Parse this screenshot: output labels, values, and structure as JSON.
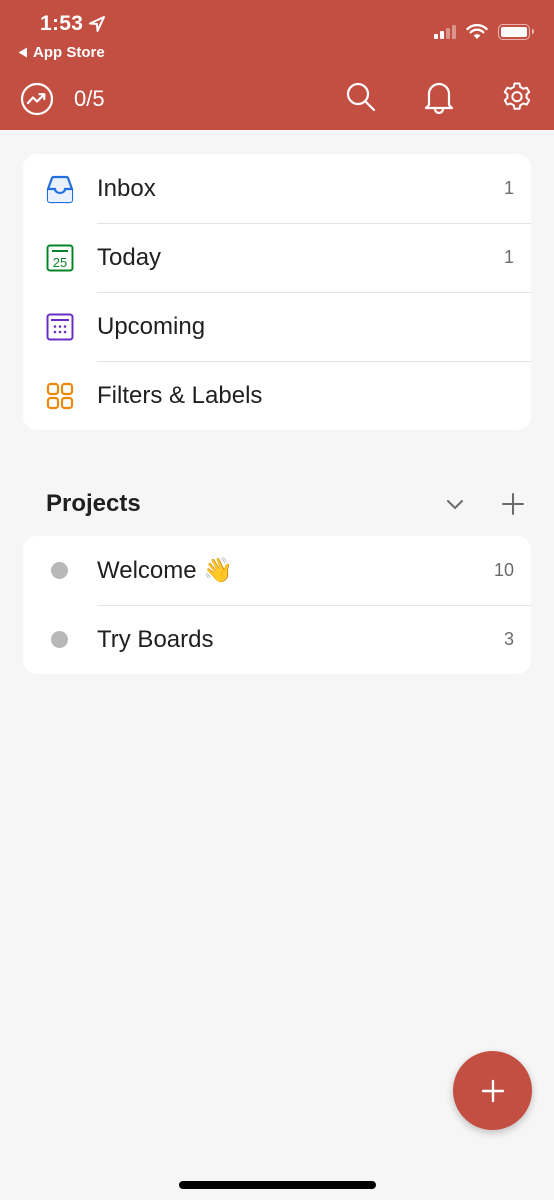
{
  "status_bar": {
    "time": "1:53",
    "back_label": "App Store",
    "signal_bars_active": 2,
    "signal_bars_total": 4,
    "battery_level": 1.0
  },
  "header": {
    "karma_icon": "productivity-trend-icon",
    "karma_progress": "0/5",
    "actions": [
      {
        "name": "search",
        "icon": "search-icon"
      },
      {
        "name": "notifications",
        "icon": "bell-icon"
      },
      {
        "name": "settings",
        "icon": "gear-icon"
      }
    ],
    "accent_color": "#c24f41"
  },
  "nav": {
    "items": [
      {
        "label": "Inbox",
        "count": "1",
        "icon": "inbox-icon",
        "color": "#246fe0"
      },
      {
        "label": "Today",
        "count": "1",
        "icon": "calendar-today-icon",
        "day": "25",
        "color": "#058527"
      },
      {
        "label": "Upcoming",
        "count": "",
        "icon": "calendar-upcoming-icon",
        "color": "#692fc2"
      },
      {
        "label": "Filters & Labels",
        "count": "",
        "icon": "filters-grid-icon",
        "color": "#eb8909"
      }
    ]
  },
  "projects": {
    "title": "Projects",
    "items": [
      {
        "label": "Welcome 👋",
        "count": "10",
        "color": "#b8b8b8"
      },
      {
        "label": "Try Boards",
        "count": "3",
        "color": "#b8b8b8"
      }
    ]
  },
  "fab": {
    "icon": "plus-icon"
  }
}
